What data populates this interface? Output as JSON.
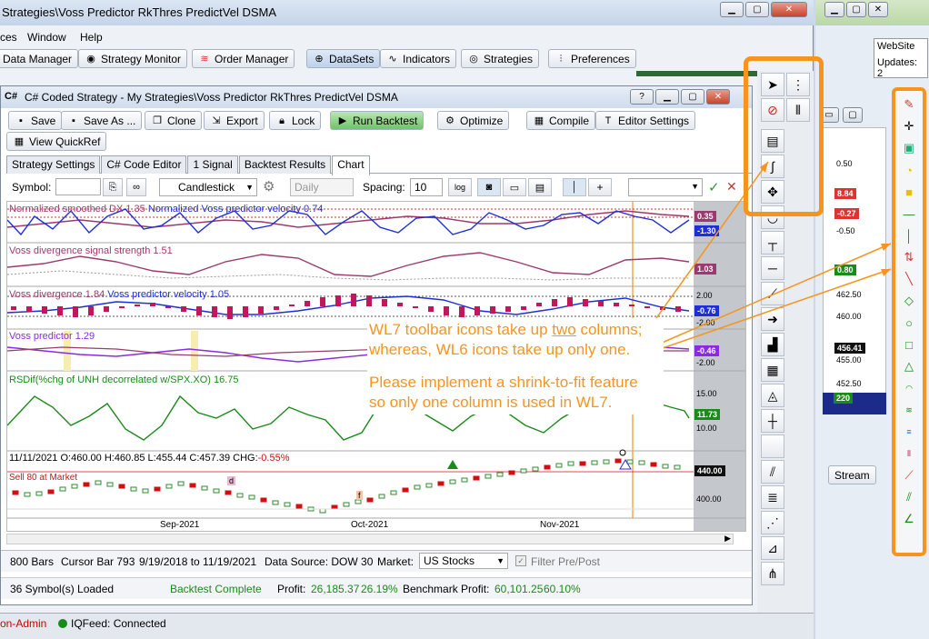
{
  "app": {
    "title": "Strategies\\Voss Predictor RkThres PredictVel DSMA",
    "menu": [
      "ces",
      "Window",
      "Help"
    ],
    "toolbar": [
      {
        "label": "Data Manager",
        "icon": "grid-icon"
      },
      {
        "label": "Strategy Monitor",
        "icon": "monitor-icon"
      },
      {
        "label": "Order Manager",
        "icon": "wifi-icon"
      },
      {
        "label": "DataSets",
        "icon": "globe-icon"
      },
      {
        "label": "Indicators",
        "icon": "wave-icon"
      },
      {
        "label": "Strategies",
        "icon": "strategy-icon"
      },
      {
        "label": "Preferences",
        "icon": "sliders-icon"
      }
    ]
  },
  "strategy": {
    "title": "C# Coded Strategy - My Strategies\\Voss Predictor RkThres PredictVel DSMA",
    "buttons": {
      "save": "Save",
      "save_as": "Save As ...",
      "clone": "Clone",
      "export": "Export",
      "lock": "Lock",
      "run_backtest": "Run Backtest",
      "optimize": "Optimize",
      "compile": "Compile",
      "editor_settings": "Editor Settings",
      "view_quickref": "View QuickRef"
    },
    "tabs": [
      "Strategy Settings",
      "C# Code Editor",
      "1 Signal",
      "Backtest Results",
      "Chart"
    ],
    "chart_toolbar": {
      "symbol_label": "Symbol:",
      "chart_style": "Candlestick",
      "scale": "Daily",
      "spacing_label": "Spacing:",
      "spacing_value": "10",
      "log_label": "log"
    }
  },
  "panes": {
    "p1_label1": "Normalized smoothed DX 1.35",
    "p1_label2": "Normalized Voss predictor velocity 0.74",
    "p1_axis": [
      "0.35",
      "-1.30"
    ],
    "p2_label": "Voss divergence signal strength 1.51",
    "p2_axis": [
      "1.03"
    ],
    "p3_label1": "Voss divergence 1.84",
    "p3_label2": "Voss predictor velocity 1.05",
    "p3_axis": [
      "2.00",
      "-0.76",
      "-2.00"
    ],
    "p4_label": "Voss predictor 1.29",
    "p4_axis": [
      "-0.46",
      "-2.00"
    ],
    "p5_label": "RSDif(%chg of UNH decorrelated w/SPX.XO) 16.75",
    "p5_axis": [
      "15.00",
      "11.73",
      "10.00"
    ],
    "price": {
      "date": "11/11/2021",
      "o": "O:460.00",
      "h": "H:460.85",
      "l": "L:455.44",
      "c": "C:457.39",
      "chg_label": "CHG:",
      "chg": "-0.55%",
      "signal": "Sell 80 at Market",
      "axis": [
        "440.00",
        "400.00"
      ],
      "marker_d": "d",
      "marker_f": "f"
    },
    "x_labels": [
      "Sep-2021",
      "Oct-2021",
      "Nov-2021"
    ]
  },
  "annotation": {
    "line1a": "WL7 toolbar icons take up ",
    "line1b": "two",
    "line1c": " columns;",
    "line2": "whereas, WL6 icons take up only one.",
    "line3": "Please implement a shrink-to-fit feature",
    "line4": "so only one column is used in WL7."
  },
  "status1": {
    "bars": "800 Bars",
    "cursor": "Cursor Bar 793",
    "range": "9/19/2018 to 11/19/2021",
    "source": "Data Source: DOW 30",
    "market_label": "Market:",
    "market": "US Stocks",
    "filter": "Filter Pre/Post"
  },
  "status2": {
    "loaded": "36 Symbol(s) Loaded",
    "backtest": "Backtest Complete",
    "profit_label": "Profit:",
    "profit": "26,185.37",
    "profit_pct": "26.19%",
    "bench_label": "Benchmark Profit:",
    "bench": "60,101.25",
    "bench_pct": "60.10%"
  },
  "bottom": {
    "admin": "on-Admin",
    "feed": "IQFeed: Connected"
  },
  "right_window": {
    "website": "WebSite",
    "updates": "Updates: 2",
    "axis": [
      "0.50",
      "8.84",
      "-0.27",
      "-0.50",
      "0.80",
      "462.50",
      "460.00",
      "456.41",
      "455.00",
      "452.50",
      "220"
    ],
    "stream": "Stream"
  },
  "colors": {
    "orange": "#f7941d",
    "dx": "#9b3a6e",
    "velocity": "#1e2fd8",
    "purple": "#8a2be2",
    "green": "#1a8a1a",
    "bar_mag": "#c2185b",
    "up_candle": "#2e8b2e",
    "down_candle": "#d01010"
  }
}
